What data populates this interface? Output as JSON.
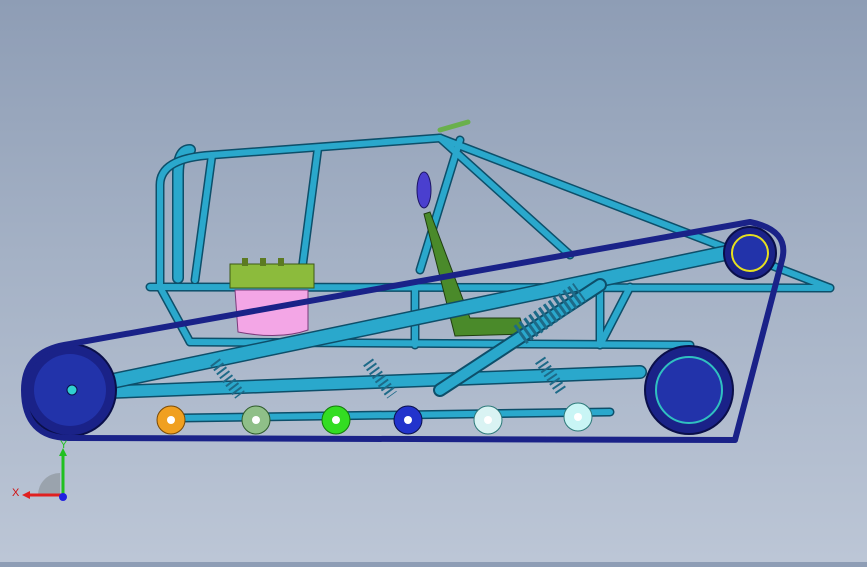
{
  "viewport": {
    "background_top": "#8e9db5",
    "background_bottom": "#bcc6d6"
  },
  "model": {
    "frame_color": "#2aa8cc",
    "frame_edge": "#0d4f6a",
    "track_color": "#1a2288",
    "drive_sprocket_color": "#2233aa",
    "engine_color": "#8cbb3c",
    "tank_color": "#f3a6e6",
    "seat_color": "#4a8a2a",
    "headrest_color": "#4a3fcf",
    "wheel_colors": [
      "#f0a020",
      "#8fbf88",
      "#33dd22",
      "#2233cc",
      "#d9f3f3",
      "#c9f5f5"
    ]
  },
  "triad": {
    "x_label": "X",
    "y_label": "Y",
    "x_color": "#e02020",
    "y_color": "#20c020",
    "z_color": "#2020e0"
  }
}
